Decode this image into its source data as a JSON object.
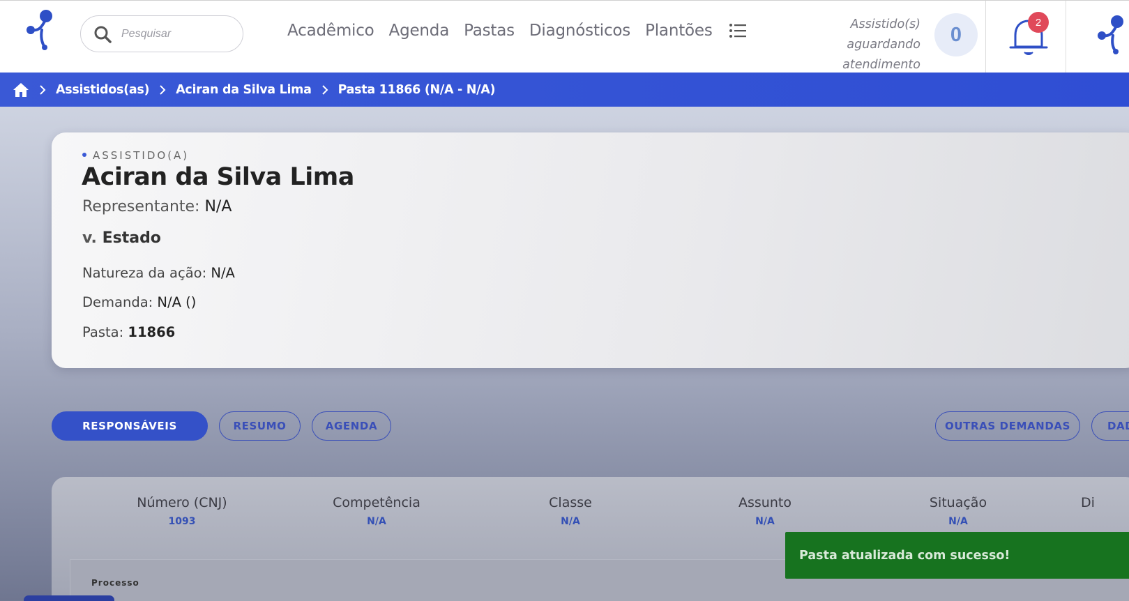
{
  "header": {
    "search_placeholder": "Pesquisar",
    "nav": [
      "Acadêmico",
      "Agenda",
      "Pastas",
      "Diagnósticos",
      "Plantões"
    ],
    "waiting_label_lines": [
      "Assistido(s)",
      "aguardando",
      "atendimento"
    ],
    "waiting_count": "0",
    "notification_count": "2"
  },
  "breadcrumb": [
    "Assistidos(as)",
    "Aciran da Silva Lima",
    "Pasta 11866 (N/A - N/A)"
  ],
  "card": {
    "eyebrow": "ASSISTIDO(A)",
    "name": "Aciran da Silva Lima",
    "representante_label": "Representante:",
    "representante_value": "N/A",
    "versus_prefix": "v.",
    "versus_value": "Estado",
    "natureza_label": "Natureza da ação:",
    "natureza_value": "N/A",
    "demanda_label": "Demanda:",
    "demanda_value": "N/A ()",
    "pasta_label": "Pasta:",
    "pasta_value": "11866"
  },
  "tabs": {
    "responsaveis": "RESPONSÁVEIS",
    "resumo": "RESUMO",
    "agenda": "AGENDA",
    "outras_demandas": "OUTRAS DEMANDAS",
    "dados_partial": "DAD"
  },
  "process_table": {
    "columns": [
      {
        "header": "Número (CNJ)",
        "value": "1093"
      },
      {
        "header": "Competência",
        "value": "N/A"
      },
      {
        "header": "Classe",
        "value": "N/A"
      },
      {
        "header": "Assunto",
        "value": "N/A"
      },
      {
        "header": "Situação",
        "value": "N/A"
      },
      {
        "header": "Di",
        "value": ""
      }
    ],
    "section_label": "Processo"
  },
  "toast": "Pasta atualizada com sucesso!",
  "colors": {
    "primary": "#3451c8",
    "breadcrumb_bg": "#3a59d6",
    "toast_bg": "#17731f",
    "badge": "#e0495a"
  }
}
